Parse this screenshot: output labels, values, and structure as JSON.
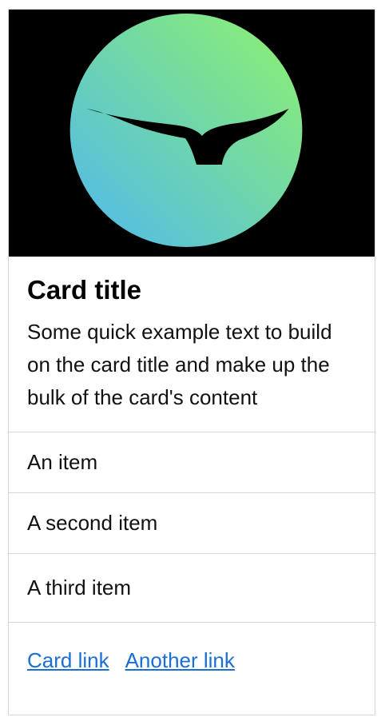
{
  "card": {
    "image": {
      "icon": "bird-wings-logo-icon",
      "background_color": "#000000",
      "gradient_start": "#5bc0e6",
      "gradient_end": "#8ef07a",
      "mark_color": "#000000"
    },
    "title": "Card title",
    "text": "Some quick example text to build on the card title and make up the bulk of the card's content",
    "items": [
      {
        "label": "An item"
      },
      {
        "label": "A second item"
      },
      {
        "label": "A third item"
      }
    ],
    "links": [
      {
        "label": "Card link"
      },
      {
        "label": "Another link"
      }
    ],
    "colors": {
      "link": "#1a6fd6",
      "border": "#d6d6d6"
    }
  }
}
